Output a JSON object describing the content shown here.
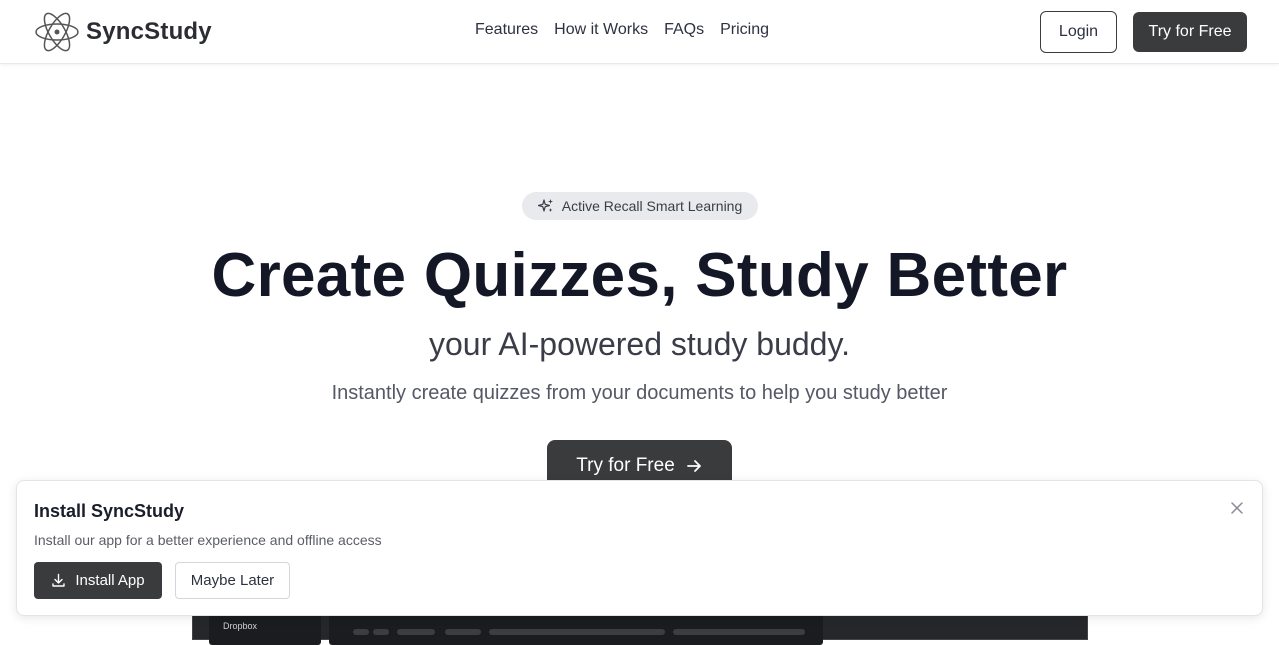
{
  "header": {
    "brand_name": "SyncStudy",
    "nav": [
      "Features",
      "How it Works",
      "FAQs",
      "Pricing"
    ],
    "login_label": "Login",
    "try_label": "Try for Free"
  },
  "hero": {
    "badge": "Active Recall Smart Learning",
    "title": "Create Quizzes, Study Better",
    "subtitle": "your AI-powered study buddy.",
    "description": "Instantly create quizzes from your documents to help you study better",
    "cta_label": "Try for Free"
  },
  "preview": {
    "sidebar_label": "Dropbox"
  },
  "install_prompt": {
    "title": "Install SyncStudy",
    "description": "Install our app for a better experience and offline access",
    "install_label": "Install App",
    "later_label": "Maybe Later"
  },
  "icons": {
    "logo": "atom-icon",
    "badge": "sparkles-icon",
    "cta": "arrow-right-icon",
    "install": "download-icon",
    "close": "close-icon"
  },
  "colors": {
    "primary_button": "#3a3b3d",
    "heading": "#141826",
    "badge_bg": "#e9eaee"
  }
}
